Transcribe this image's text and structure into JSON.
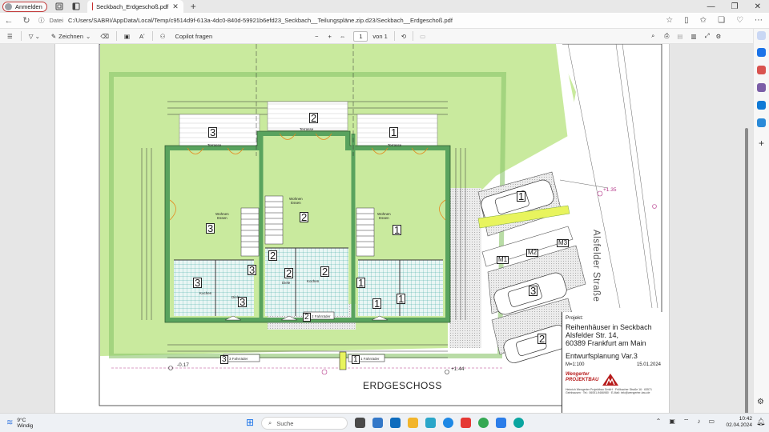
{
  "browser": {
    "profile_label": "Anmelden",
    "tab_title": "Seckbach_Erdgeschoß.pdf",
    "url_label": "Datei",
    "url": "C:/Users/SABRI/AppData/Local/Temp/c9514d9f-613a-4dc0-840d-59921b6efd23_Seckbach__Teilungspläne.zip.d23/Seckbach__Erdgeschoß.pdf"
  },
  "pdf_toolbar": {
    "draw_label": "Zeichnen",
    "copilot_label": "Copilot fragen",
    "page_current": "1",
    "page_of": "von 1"
  },
  "plan": {
    "units": {
      "left": "3",
      "middle": "2",
      "right": "1"
    },
    "rooms": {
      "terrasse": "Terrasse",
      "wohnen": "Wohnen\nEssen",
      "kochen": "Kochen",
      "diele": "Diele"
    },
    "parking": {
      "m1": "M1",
      "m2": "M2",
      "m3": "M3",
      "car1": "1",
      "car2": "2",
      "car3": "3"
    },
    "fahrraeder": [
      "3 Fahrräder",
      "2 Fahrräder",
      "1 Fahrräder"
    ],
    "levels": {
      "left": "-0.17",
      "right": "+1.44",
      "tree": "+1.35"
    },
    "floor_title": "ERDGESCHOSS",
    "street": "Alsfelder Straße"
  },
  "title_block": {
    "heading": "Projekt:",
    "project_lines": [
      "Reihenhäuser in Seckbach",
      "Alsfelder Str. 14,",
      "60389 Frankfurt am Main"
    ],
    "variant": "Entwurfsplanung Var.3",
    "scale": "M=1:100",
    "date": "15.01.2024",
    "company_line1": "Wengerter",
    "company_line2": "PROJEKTBAU",
    "company_address": "Heinrich Wengerter Projektbau GmbH · Frölbacher Straße 16 · 63571 Gelnhausen · Tel.: 06051-9466980 · E-Mail: info@wengerter-bau.de"
  },
  "taskbar": {
    "weather_temp": "9°C",
    "weather_desc": "Windig",
    "search_placeholder": "Suche",
    "time": "10:42",
    "date": "02.04.2024"
  },
  "colors": {
    "lawn": "#c9ea9e",
    "wall": "#59a35e",
    "tile": "#3aa6a0",
    "accent_edge": "#3b7be0"
  }
}
